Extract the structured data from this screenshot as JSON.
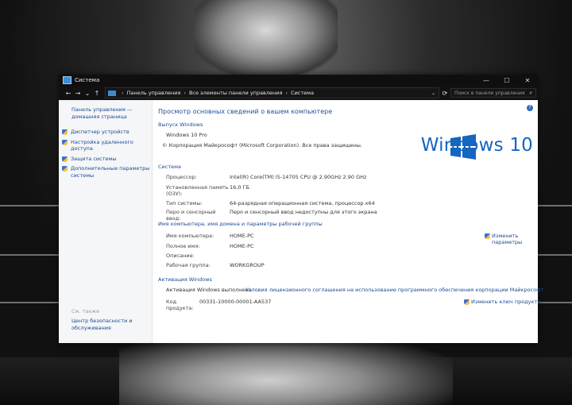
{
  "window": {
    "title": "Система"
  },
  "titlebar": {
    "minimize": "—",
    "maximize": "☐",
    "close": "✕"
  },
  "addressbar": {
    "back": "←",
    "forward": "→",
    "down": "⌄",
    "up": "↑",
    "crumbs": [
      "Панель управления",
      "Все элементы панели управления",
      "Система"
    ],
    "separator": "›",
    "dropdown": "⌄",
    "refresh": "⟳",
    "search_placeholder": "Поиск в панели управления",
    "search_icon": "⌕"
  },
  "sidebar": {
    "home": "Панель управления — домашняя страница",
    "items": [
      {
        "label": "Диспетчер устройств",
        "icon": "shield-icon"
      },
      {
        "label": "Настройка удаленного доступа",
        "icon": "shield-icon"
      },
      {
        "label": "Защита системы",
        "icon": "shield-icon"
      },
      {
        "label": "Дополнительные параметры системы",
        "icon": "shield-icon"
      }
    ],
    "see_also": "См. также",
    "security_center": "Центр безопасности и обслуживания"
  },
  "main": {
    "help": "?",
    "heading": "Просмотр основных сведений о вашем компьютере",
    "edition": {
      "title": "Выпуск Windows",
      "name": "Windows 10 Pro",
      "copyright": "© Корпорация Майкрософт (Microsoft Corporation). Все права защищены.",
      "logo_text": "Windows 10",
      "logo_color": "#1566c0"
    },
    "system": {
      "title": "Система",
      "rows": [
        {
          "label": "Процессор:",
          "value": "Intel(R) Core(TM) i5-14705 CPU @ 2.90GHz   2.90 GHz"
        },
        {
          "label": "Установленная память (ОЗУ):",
          "value": "16,0 ГБ"
        },
        {
          "label": "Тип системы:",
          "value": "64-разрядная операционная система, процессор x64"
        },
        {
          "label": "Перо и сенсорный ввод:",
          "value": "Перо и сенсорный ввод недоступны для этого экрана"
        }
      ]
    },
    "computer": {
      "title": "Имя компьютера, имя домена и параметры рабочей группы",
      "rows": [
        {
          "label": "Имя компьютера:",
          "value": "HOME-PC"
        },
        {
          "label": "Полное имя:",
          "value": "HOME-PC"
        },
        {
          "label": "Описание:",
          "value": ""
        },
        {
          "label": "Рабочая группа:",
          "value": "WORKGROUP"
        }
      ],
      "change_settings": "Изменить параметры"
    },
    "activation": {
      "title": "Активация Windows",
      "status": "Активация Windows выполнена",
      "license_link": "Условия лицензионного соглашения на использование программного обеспечения корпорации Майкрософт",
      "product_label": "Код продукта:",
      "product_id": "00331-10000-00001-AA537",
      "change_key": "Изменить ключ продукта"
    }
  }
}
